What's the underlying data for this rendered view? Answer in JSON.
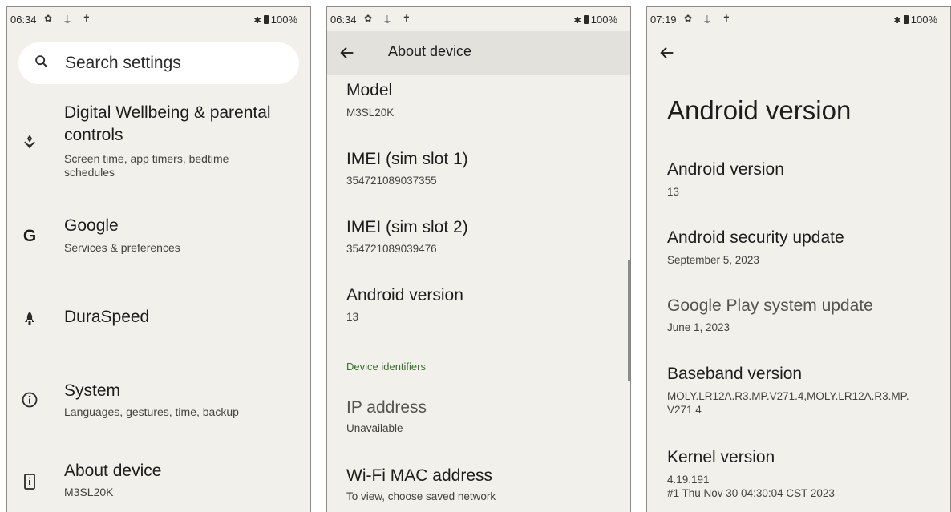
{
  "panel_settings": {
    "status": {
      "time": "06:34",
      "battery": "100%"
    },
    "search": {
      "placeholder": "Search settings"
    },
    "items": [
      {
        "icon": "digital-wellbeing-icon",
        "title_line1": "Digital Wellbeing & parental",
        "title_line2": "controls",
        "subtitle_line1": "Screen time, app timers, bedtime",
        "subtitle_line2": "schedules"
      },
      {
        "icon": "google-g-icon",
        "title": "Google",
        "subtitle": "Services & preferences"
      },
      {
        "icon": "duraspeed-rocket-icon",
        "title": "DuraSpeed"
      },
      {
        "icon": "info-circle-icon",
        "title": "System",
        "subtitle": "Languages, gestures, time, backup"
      },
      {
        "icon": "phone-info-icon",
        "title": "About device",
        "subtitle": "M3SL20K"
      }
    ]
  },
  "panel_about": {
    "status": {
      "time": "06:34",
      "battery": "100%"
    },
    "appbar_title": "About device",
    "rows": [
      {
        "title": "Model",
        "value": "M3SL20K"
      },
      {
        "title": "IMEI (sim slot 1)",
        "value": "354721089037355"
      },
      {
        "title": "IMEI (sim slot 2)",
        "value": "354721089039476"
      },
      {
        "title": "Android version",
        "value": "13"
      }
    ],
    "section_header": "Device identifiers",
    "rows2": [
      {
        "title": "IP address",
        "value": "Unavailable"
      },
      {
        "title": "Wi-Fi MAC address",
        "value": "To view, choose saved network"
      }
    ]
  },
  "panel_android": {
    "status": {
      "time": "07:19",
      "battery": "100%"
    },
    "page_title": "Android version",
    "rows": [
      {
        "title": "Android version",
        "value": "13"
      },
      {
        "title": "Android security update",
        "value": "September 5, 2023"
      },
      {
        "title": "Google Play system update",
        "value": "June 1, 2023"
      },
      {
        "title": "Baseband version",
        "value_line1": "MOLY.LR12A.R3.MP.V271.4,MOLY.LR12A.R3.MP.",
        "value_line2": "V271.4"
      },
      {
        "title": "Kernel version",
        "value_line1": "4.19.191",
        "value_line2": "#1 Thu Nov 30 04:30:04 CST 2023"
      }
    ]
  },
  "colors": {
    "panel_bg": "#f1f0eb",
    "appbar_bg": "#e2e1dc",
    "section_header": "#3b6f2e",
    "search_bg": "#ffffff"
  }
}
